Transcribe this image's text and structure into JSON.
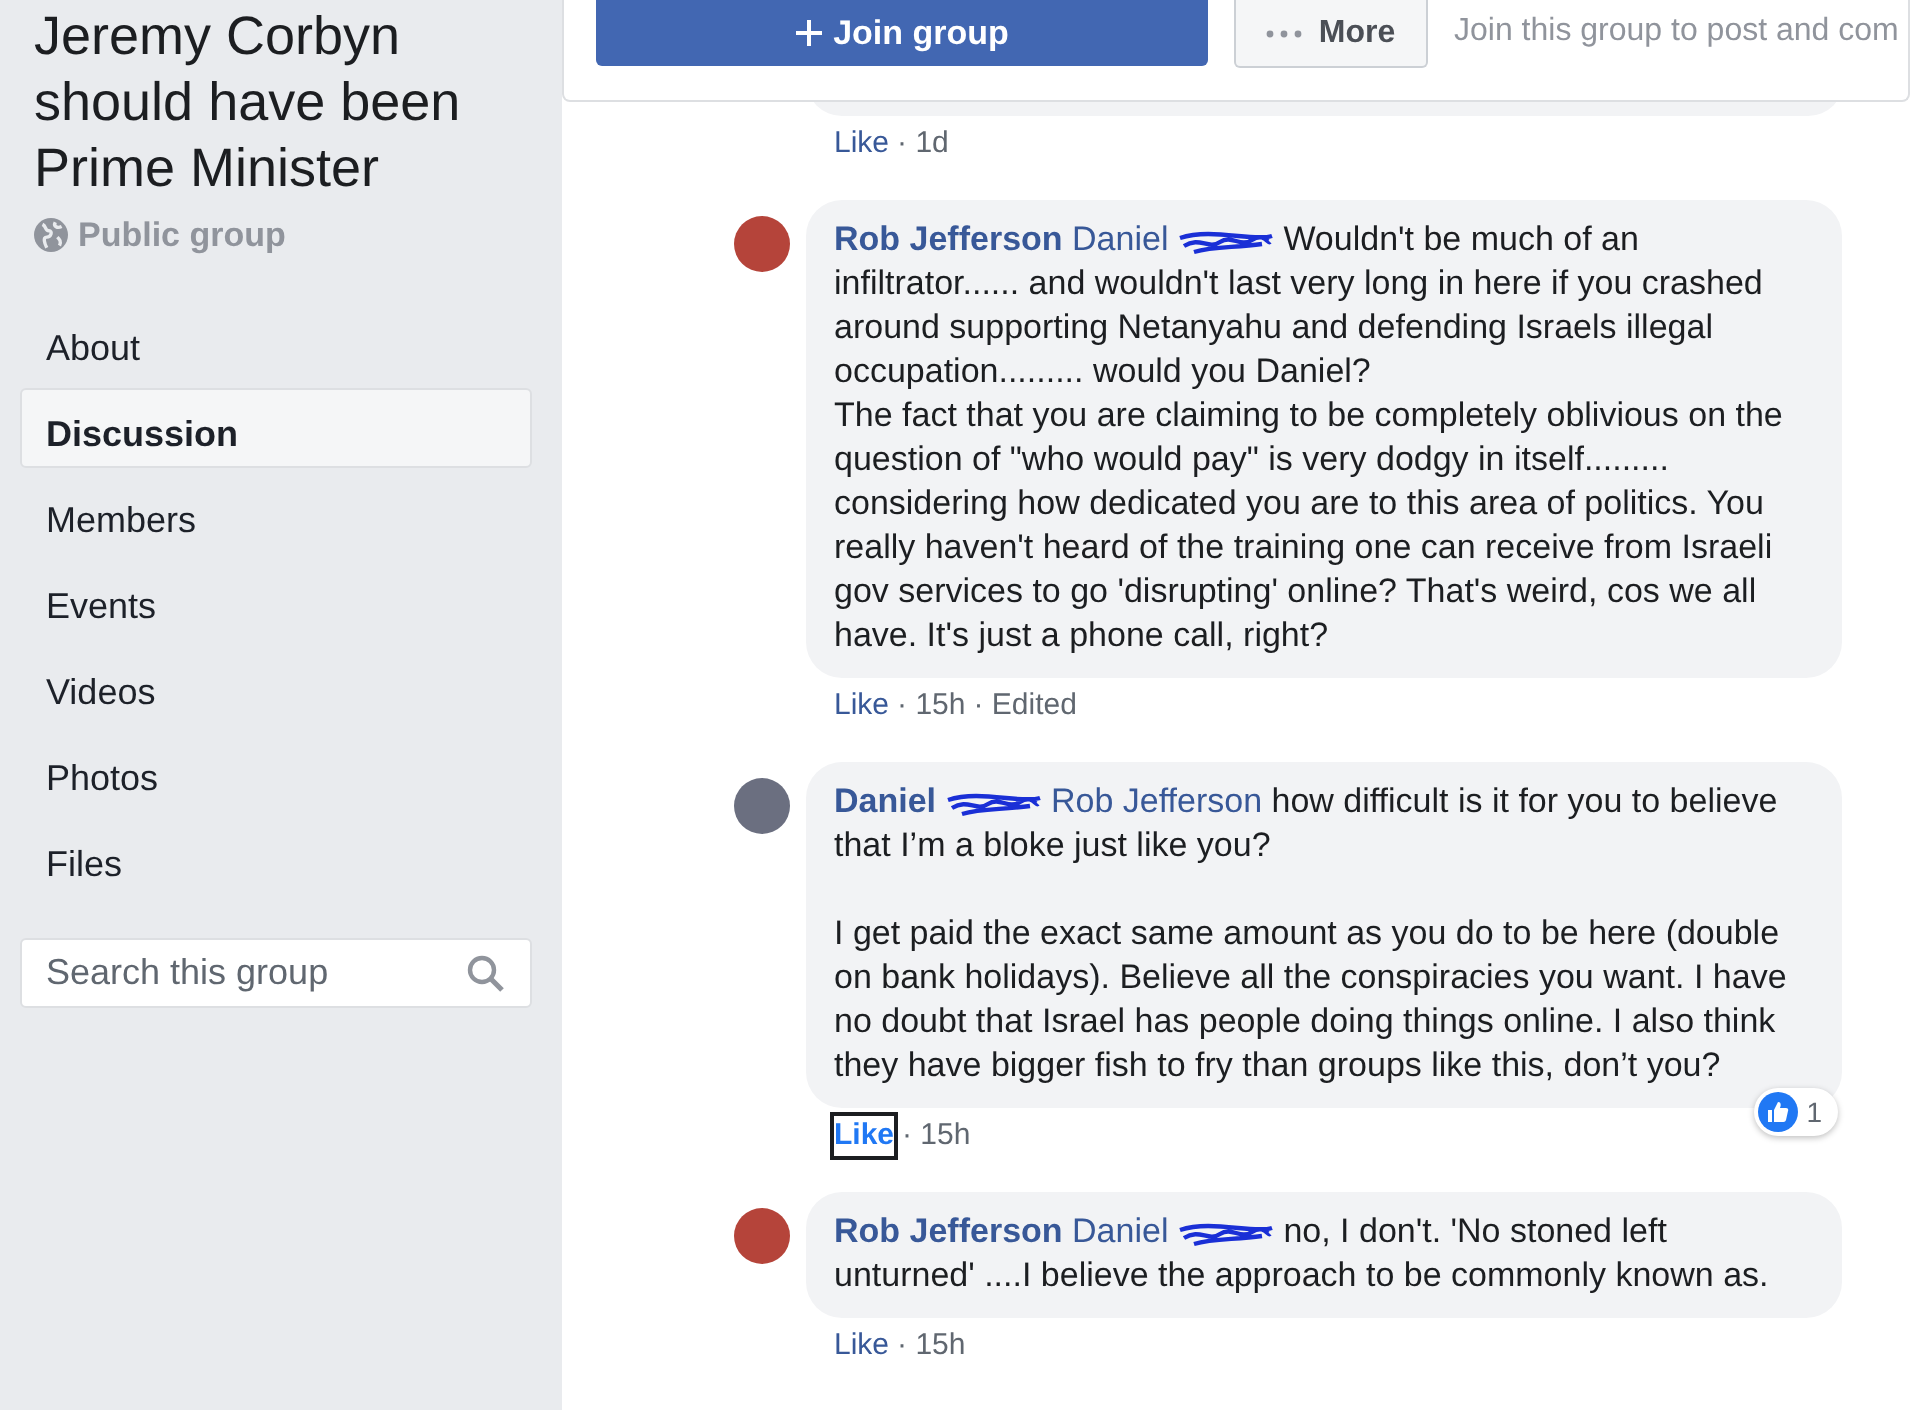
{
  "group": {
    "title": "Jeremy Corbyn should have been Prime Minister",
    "privacy": "Public group"
  },
  "nav": [
    {
      "label": "About",
      "selected": false
    },
    {
      "label": "Discussion",
      "selected": true
    },
    {
      "label": "Members",
      "selected": false
    },
    {
      "label": "Events",
      "selected": false
    },
    {
      "label": "Videos",
      "selected": false
    },
    {
      "label": "Photos",
      "selected": false
    },
    {
      "label": "Files",
      "selected": false
    }
  ],
  "search": {
    "placeholder": "Search this group"
  },
  "header": {
    "join_button": "Join group",
    "more_button": "More",
    "notice": "Join this group to post and com"
  },
  "previous_comment": {
    "like": "Like",
    "meta": [
      "· 1d"
    ]
  },
  "comments": [
    {
      "author": "Rob Jefferson",
      "author_redacted": false,
      "color": "#b5443a",
      "mention": "Daniel",
      "mention_redacted": true,
      "text": "Wouldn't be much of an infiltrator...... and wouldn't last very long in here if you crashed around supporting Netanyahu and defending Israels illegal occupation......... would you Daniel?\nThe fact that you are claiming to be completely oblivious on the question of \"who would pay\" is very dodgy in itself......... considering how dedicated you are to this area of politics. You really haven't heard of the training one can receive from Israeli gov services to go 'disrupting' online? That's weird, cos we all have. It's just a phone call, right?",
      "like": "Like",
      "liked": false,
      "focused": false,
      "meta": [
        "· 15h",
        "· Edited"
      ]
    },
    {
      "author": "Daniel",
      "author_redacted": true,
      "color": "#6b6f80",
      "mention": "Rob Jefferson",
      "mention_redacted": false,
      "text": "how difficult is it for you to believe that I’m a bloke just like you?\n\nI get paid the exact same amount as you do to be here (double on bank holidays). Believe all the conspiracies you want. I have no doubt that Israel has people doing things online. I also think they have bigger fish to fry than groups like this, don’t you?",
      "like": "Like",
      "liked": true,
      "focused": true,
      "meta": [
        "· 15h"
      ],
      "reactions": {
        "count": "1"
      }
    },
    {
      "author": "Rob Jefferson",
      "author_redacted": false,
      "color": "#b5443a",
      "mention": "Daniel",
      "mention_redacted": true,
      "text": "no, I don't. 'No stoned left unturned' ....I believe the approach to be commonly known as.",
      "like": "Like",
      "liked": false,
      "focused": false,
      "meta": [
        "· 15h"
      ]
    }
  ]
}
